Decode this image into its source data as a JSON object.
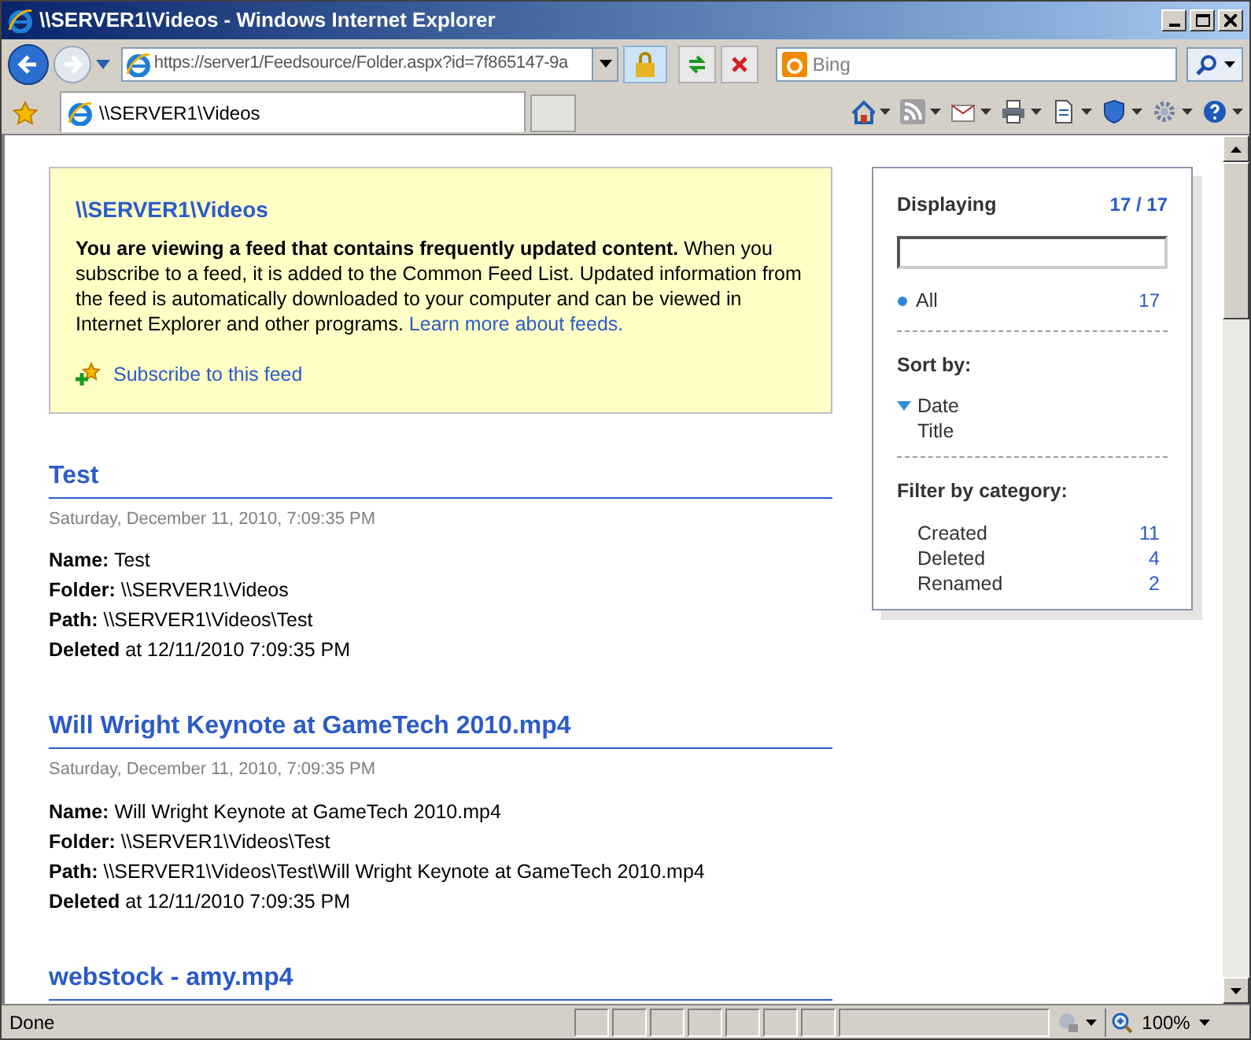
{
  "window": {
    "title": "\\\\SERVER1\\Videos - Windows Internet Explorer"
  },
  "address_bar": {
    "url": "https://server1/Feedsource/Folder.aspx?id=7f865147-9a"
  },
  "search": {
    "placeholder": "Bing"
  },
  "tabs": [
    {
      "label": "\\\\SERVER1\\Videos",
      "selected": true
    }
  ],
  "feed_header": {
    "title": "\\\\SERVER1\\Videos",
    "intro": "**You are viewing a feed that contains frequently updated content.** When you subscribe to a feed, it is added to the Common Feed List. Updated information from the feed is automatically downloaded to your computer and can be viewed in Internet Explorer and other programs.",
    "learn_more_link": "Learn more about feeds.",
    "subscribe_link": "Subscribe to this feed"
  },
  "entries": [
    {
      "title": "Test",
      "date": "Saturday, December 11, 2010, 7:09:35 PM",
      "lines": [
        "**Name:** Test",
        "**Folder:** \\\\SERVER1\\Videos",
        "**Path:** \\\\SERVER1\\Videos\\Test",
        "**Deleted** at 12/11/2010 7:09:35 PM"
      ]
    },
    {
      "title": "Will Wright Keynote at GameTech 2010.mp4",
      "date": "Saturday, December 11, 2010, 7:09:35 PM",
      "lines": [
        "**Name:** Will Wright Keynote at GameTech 2010.mp4",
        "**Folder:** \\\\SERVER1\\Videos\\Test",
        "**Path:** \\\\SERVER1\\Videos\\Test\\Will Wright Keynote at GameTech 2010.mp4",
        "**Deleted** at 12/11/2010 7:09:35 PM"
      ]
    },
    {
      "title": "webstock - amy.mp4"
    }
  ],
  "sidebar": {
    "displaying_label": "Displaying",
    "displaying_count": "17 / 17",
    "all": {
      "label": "All",
      "count": "17",
      "selected": true
    },
    "sort_label": "Sort by:",
    "sort_options": [
      {
        "label": "Date",
        "selected": true
      },
      {
        "label": "Title",
        "selected": false
      }
    ],
    "filter_label": "Filter by category:",
    "categories": [
      {
        "label": "Created",
        "count": "11"
      },
      {
        "label": "Deleted",
        "count": "4"
      },
      {
        "label": "Renamed",
        "count": "2"
      }
    ]
  },
  "status_bar": {
    "text": "Done",
    "zoom": "100%"
  }
}
